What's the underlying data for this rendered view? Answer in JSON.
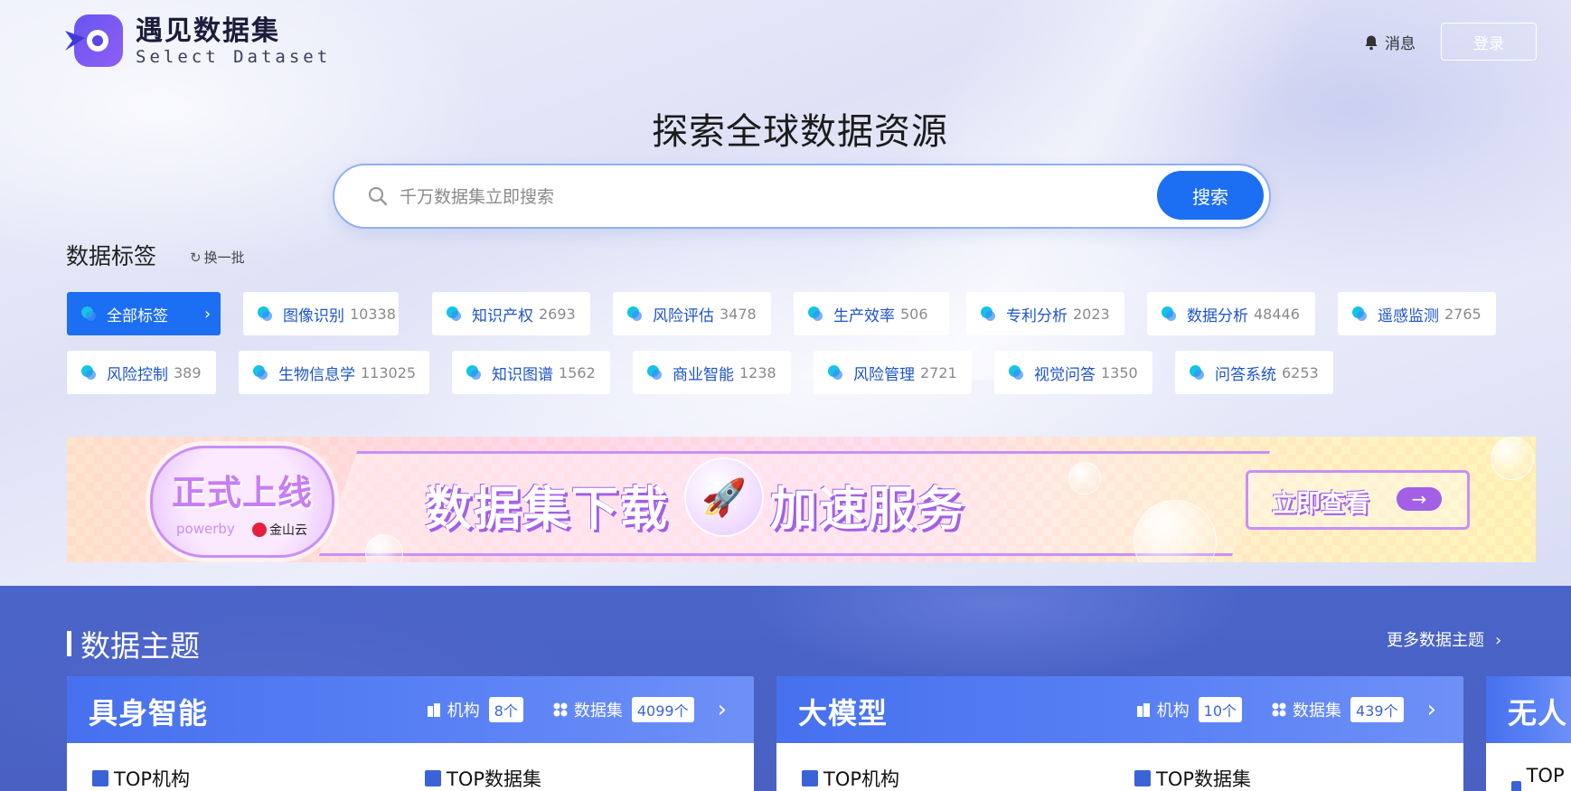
{
  "header": {
    "logo_title": "遇见数据集",
    "logo_subtitle": "Select Dataset",
    "messages_label": "消息",
    "login_label": "登录"
  },
  "hero": {
    "title": "探索全球数据资源",
    "search_placeholder": "千万数据集立即搜索",
    "search_button": "搜索"
  },
  "tags": {
    "title": "数据标签",
    "refresh_label": "换一批",
    "all_label": "全部标签",
    "items": [
      {
        "label": "图像识别",
        "count": "10338"
      },
      {
        "label": "知识产权",
        "count": "2693"
      },
      {
        "label": "风险评估",
        "count": "3478"
      },
      {
        "label": "生产效率",
        "count": "506"
      },
      {
        "label": "专利分析",
        "count": "2023"
      },
      {
        "label": "数据分析",
        "count": "48446"
      },
      {
        "label": "遥感监测",
        "count": "2765"
      },
      {
        "label": "风险控制",
        "count": "389"
      },
      {
        "label": "生物信息学",
        "count": "113025"
      },
      {
        "label": "知识图谱",
        "count": "1562"
      },
      {
        "label": "商业智能",
        "count": "1238"
      },
      {
        "label": "风险管理",
        "count": "2721"
      },
      {
        "label": "视觉问答",
        "count": "1350"
      },
      {
        "label": "问答系统",
        "count": "6253"
      }
    ]
  },
  "banner": {
    "badge_title": "正式上线",
    "badge_powered": "powerby",
    "badge_brand": "金山云",
    "left_text": "数据集下载",
    "right_text": "加速服务",
    "button_label": "立即查看"
  },
  "topics": {
    "title": "数据主题",
    "more_label": "更多数据主题",
    "org_label": "机构",
    "dataset_label": "数据集",
    "top_org_label": "TOP机构",
    "top_dataset_label": "TOP数据集",
    "cards": [
      {
        "name": "具身智能",
        "org_count": "8个",
        "dataset_count": "4099个"
      },
      {
        "name": "大模型",
        "org_count": "10个",
        "dataset_count": "439个"
      },
      {
        "name": "无人"
      }
    ]
  },
  "colors": {
    "accent": "#1c6ef3",
    "tag_text": "#1e55c9",
    "topics_bg": "#4a64c9",
    "banner_purple": "#c98ff5"
  }
}
